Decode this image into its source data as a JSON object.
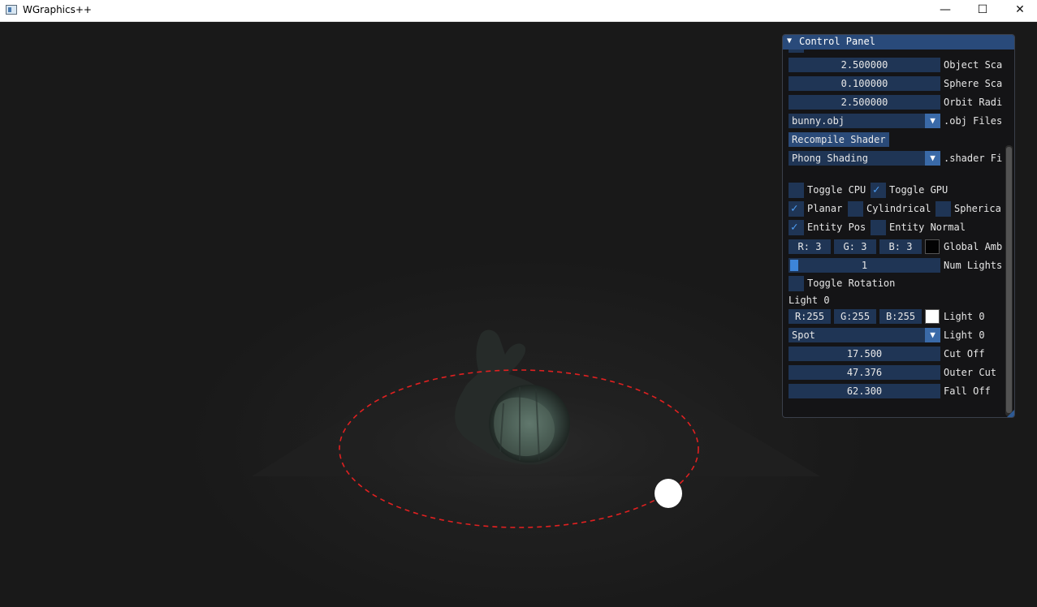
{
  "window": {
    "title": "WGraphics++",
    "minimize_glyph": "—",
    "maximize_glyph": "☐",
    "close_glyph": "✕"
  },
  "colors": {
    "panel_header": "#294a7a",
    "field_bg": "#1f3555",
    "checkbox_tick": "#4f9ff5",
    "orbit_line": "#e02020",
    "light_sphere": "#ffffff",
    "global_ambient_swatch": "#030303",
    "light0_swatch": "#ffffff"
  },
  "panel": {
    "title": "Control Panel",
    "collapse_icon": "▼",
    "object_scale": {
      "value": "2.500000",
      "label": "Object Sca"
    },
    "sphere_scale": {
      "value": "0.100000",
      "label": "Sphere Sca"
    },
    "orbit_radius": {
      "value": "2.500000",
      "label": "Orbit Radi"
    },
    "obj_files": {
      "value": "bunny.obj",
      "label": ".obj Files"
    },
    "recompile_button": "Recompile Shader",
    "shader_files": {
      "value": "Phong Shading",
      "label": ".shader Fi"
    },
    "toggle_cpu": {
      "label": "Toggle CPU",
      "checked": false
    },
    "toggle_gpu": {
      "label": "Toggle GPU",
      "checked": true
    },
    "planar": {
      "label": "Planar",
      "checked": true
    },
    "cylindrical": {
      "label": "Cylindrical",
      "checked": false
    },
    "spherical": {
      "label": "Spherica",
      "checked": false
    },
    "entity_pos": {
      "label": "Entity Pos",
      "checked": true
    },
    "entity_normal": {
      "label": "Entity Normal",
      "checked": false
    },
    "global_ambient": {
      "r": "R:  3",
      "g": "G:  3",
      "b": "B:  3",
      "label": "Global Amb"
    },
    "num_lights": {
      "value": "1",
      "label": "Num Lights"
    },
    "toggle_rotation": {
      "label": "Toggle Rotation",
      "checked": false
    },
    "light0_header": "Light 0",
    "light0_color": {
      "r": "R:255",
      "g": "G:255",
      "b": "B:255",
      "label": "Light 0"
    },
    "light0_type": {
      "value": "Spot",
      "label": "Light 0"
    },
    "cut_off": {
      "value": "17.500",
      "label": "Cut Off"
    },
    "outer_cut": {
      "value": "47.376",
      "label": "Outer Cut"
    },
    "fall_off": {
      "value": "62.300",
      "label": "Fall Off"
    },
    "tick_glyph": "✓",
    "dropdown_glyph": "▼"
  }
}
